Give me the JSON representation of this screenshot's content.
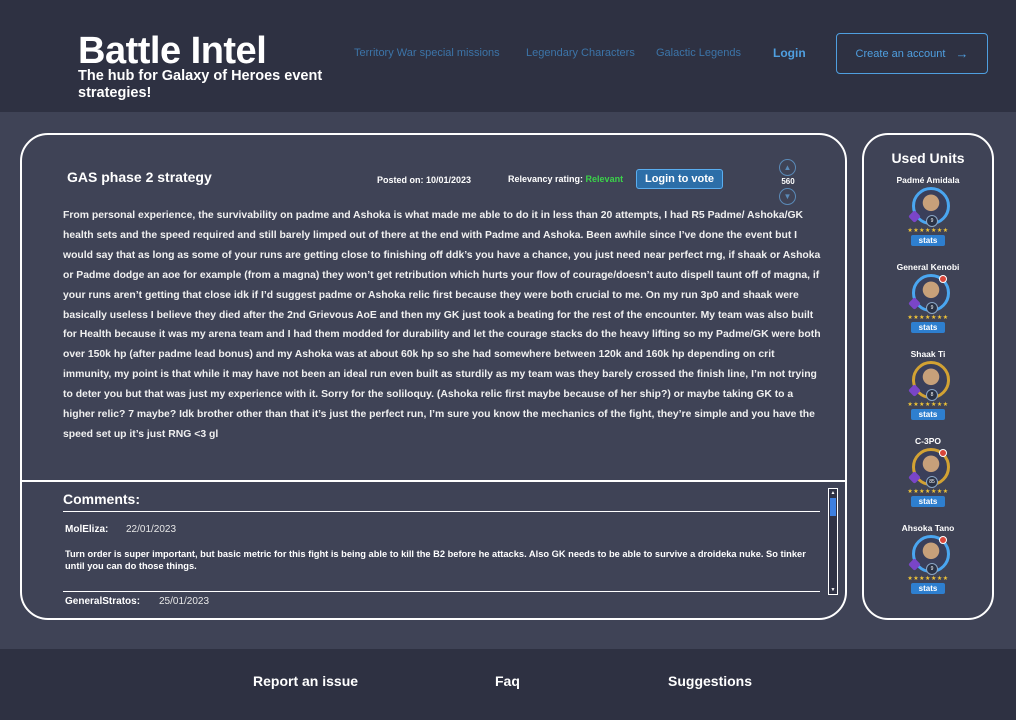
{
  "header": {
    "title": "Battle Intel",
    "subtitle": "The hub for Galaxy of Heroes event strategies!",
    "nav": [
      {
        "label": "Territory War special missions"
      },
      {
        "label": "Legendary Characters"
      },
      {
        "label": "Galactic Legends"
      }
    ],
    "login": "Login",
    "create_account": "Create an account",
    "create_arrow": "→"
  },
  "post": {
    "title": "GAS phase 2 strategy",
    "posted": "Posted on: 10/01/2023",
    "relevancy_label": "Relevancy rating:",
    "relevancy_value": "Relevant",
    "vote_button": "Login to vote",
    "vote_count": "560",
    "body": "From personal experience, the survivability on padme and Ashoka is what made me able to do it in less than 20 attempts, I had R5 Padme/ Ashoka/GK health sets and the speed required and still barely limped out of there at the end with Padme and Ashoka. Been awhile since I’ve done the event but I would say that as long as some of your runs are getting close to finishing off ddk’s you have a chance, you just need near perfect rng, if shaak or Ashoka or Padme dodge an aoe for example (from a magna) they won’t get retribution which hurts your flow of courage/doesn’t auto dispell taunt off of magna, if your runs aren’t getting that close idk if I’d suggest padme or Ashoka relic first because they were both crucial to me. On my run 3p0 and shaak were basically useless I believe they died after the 2nd Grievous AoE and then my GK just took a beating for the rest of the encounter. My team was also built for Health because it was my arena team and I had them modded for durability and let the courage stacks do the heavy lifting so my Padme/GK were both over 150k hp (after padme lead bonus) and my Ashoka was at about 60k hp so she had somewhere between 120k and 160k hp depending on crit immunity, my point is that while it may have not been an ideal run even built as sturdily as my team was they barely crossed the finish line, I’m not trying to deter you but that was just my experience with it. Sorry for the soliloquy. (Ashoka relic first maybe because of her ship?) or maybe taking GK to a higher relic? 7 maybe? Idk brother other than that it’s just the perfect run, I’m sure you know the mechanics of the fight, they’re simple and you have the speed set up it’s just RNG <3 gl"
  },
  "comments": {
    "title": "Comments:",
    "items": [
      {
        "author": "MolEliza:",
        "date": "22/01/2023",
        "text": "Turn order is super important, but basic metric for this fight is being able to kill the B2 before he attacks. Also GK needs to be able to survive a droideka nuke. So tinker until you can do those things."
      },
      {
        "author": "GeneralStratos:",
        "date": "25/01/2023",
        "text": ""
      }
    ]
  },
  "units": {
    "title": "Used Units",
    "items": [
      {
        "name": "Padmé Amidala",
        "rank": "9",
        "stars": "★★★★★★★",
        "stats": "stats"
      },
      {
        "name": "General Kenobi",
        "rank": "9",
        "stars": "★★★★★★★",
        "stats": "stats"
      },
      {
        "name": "Shaak Ti",
        "rank": "8",
        "stars": "★★★★★★★",
        "stats": "stats"
      },
      {
        "name": "C-3PO",
        "rank": "85",
        "stars": "★★★★★★★",
        "stats": "stats"
      },
      {
        "name": "Ahsoka Tano",
        "rank": "9",
        "stars": "★★★★★★★",
        "stats": "stats"
      }
    ]
  },
  "footer": {
    "links": [
      {
        "label": "Report an issue"
      },
      {
        "label": "Faq"
      },
      {
        "label": "Suggestions"
      }
    ]
  }
}
